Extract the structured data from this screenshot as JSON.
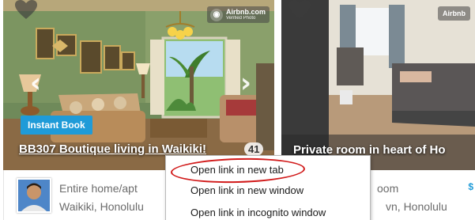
{
  "listings": [
    {
      "badge_text": "Airbnb.com",
      "badge_subtext": "Verified Photo",
      "instant_book_label": "Instant Book",
      "title": "BB307 Boutique living in Waikiki!",
      "photo_count": "41",
      "room_type": "Entire home/apt",
      "location": "Waikiki, Honolulu"
    },
    {
      "badge_text": "Airbnb",
      "title": "Private room in heart of Ho",
      "room_type_fragment": "oom",
      "location_fragment": "vn, Honolulu",
      "price_fragment": "$"
    }
  ],
  "context_menu": {
    "items": [
      {
        "label": "Open link in new tab"
      },
      {
        "label": "Open link in new window"
      },
      {
        "label": "Open link in incognito window"
      }
    ]
  },
  "colors": {
    "instant_book": "#1f9bd8",
    "highlight_ring": "#d11a1a",
    "menu_background": "#ffffff"
  },
  "icons": {
    "heart": "heart-icon",
    "arrow_prev": "chevron-left-icon",
    "arrow_next": "chevron-right-icon",
    "verified": "verified-photo-icon"
  }
}
